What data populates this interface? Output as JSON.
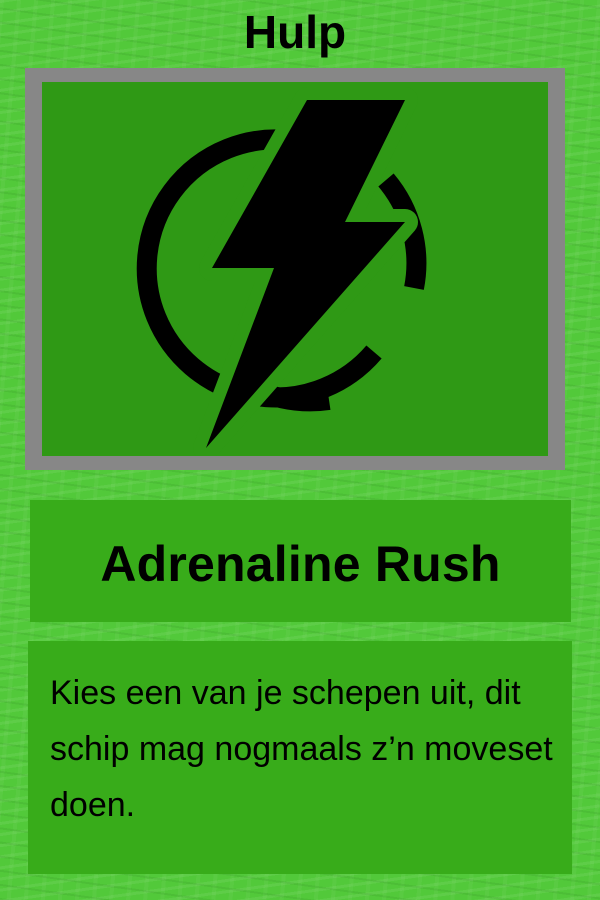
{
  "card": {
    "category": "Hulp",
    "title": "Adrenaline Rush",
    "description": "Kies een van je schepen uit, dit schip mag nogmaals z’n moveset doen.",
    "art_icon": "lightning-power-icon",
    "colors": {
      "background": "#52c93a",
      "frame": "#878787",
      "art_background": "#2f9915",
      "panel": "#38ac1a",
      "ink": "#000000"
    }
  }
}
